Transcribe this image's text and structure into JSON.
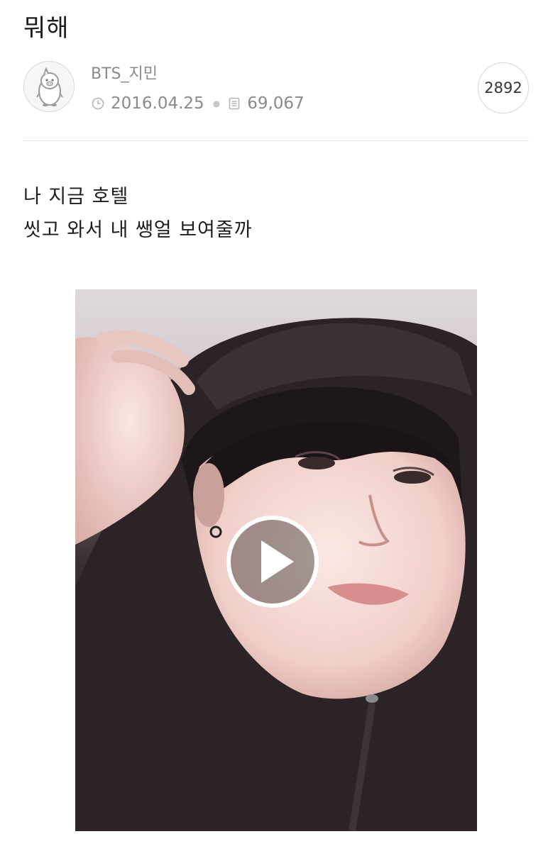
{
  "post": {
    "title": "뭐해",
    "author": {
      "name": "BTS_지민",
      "avatar_icon": "penguin-avatar-icon"
    },
    "date": "2016.04.25",
    "views": "69,067",
    "comment_count": "2892",
    "body_lines": [
      "나 지금 호텔",
      "씻고 와서 내 쌩얼 보여줄까"
    ],
    "media": {
      "type": "video",
      "play_icon": "play-icon"
    }
  },
  "icons": {
    "date": "clock-icon",
    "views": "document-icon"
  },
  "colors": {
    "meta_text": "#8a8a8a",
    "divider": "#e6e6e6",
    "play_ring": "#ffffff"
  }
}
